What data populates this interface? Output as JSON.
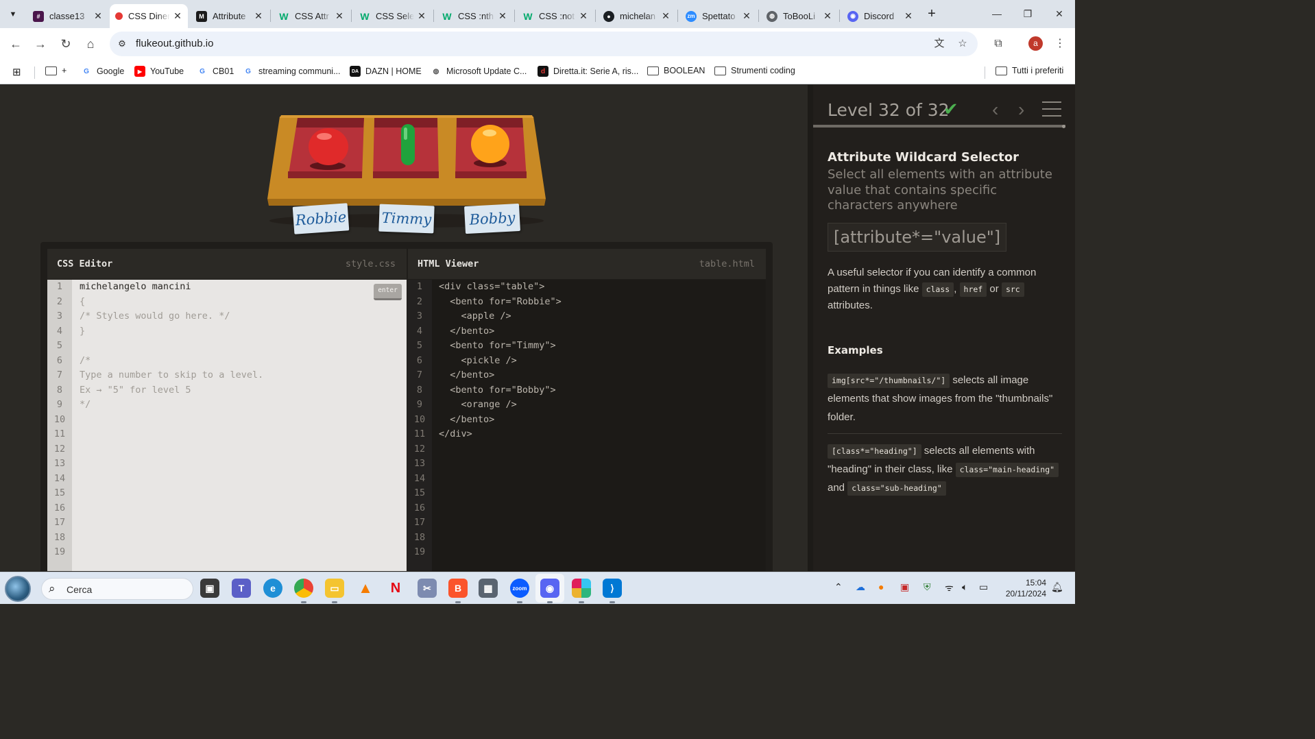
{
  "browser": {
    "tabs": [
      {
        "title": "classe13",
        "favicon": "slack-icon",
        "color": "#4a154b",
        "active": false
      },
      {
        "title": "CSS Diner",
        "favicon": "css-diner-icon",
        "color": "#e53935",
        "active": true
      },
      {
        "title": "Attribute",
        "favicon": "mdn-icon",
        "color": "#1b1b1b",
        "active": false
      },
      {
        "title": "CSS Attr",
        "favicon": "w3schools-icon",
        "color": "#04aa6d",
        "active": false
      },
      {
        "title": "CSS Sele",
        "favicon": "w3schools-icon",
        "color": "#04aa6d",
        "active": false
      },
      {
        "title": "CSS :nth",
        "favicon": "w3schools-icon",
        "color": "#04aa6d",
        "active": false
      },
      {
        "title": "CSS :not",
        "favicon": "w3schools-icon",
        "color": "#04aa6d",
        "active": false
      },
      {
        "title": "michelan",
        "favicon": "github-icon",
        "color": "#1b1f23",
        "active": false
      },
      {
        "title": "Spettato",
        "favicon": "zoom-icon",
        "color": "#2d8cff",
        "active": false
      },
      {
        "title": "ToBooLi",
        "favicon": "globe-icon",
        "color": "#5f6368",
        "active": false
      },
      {
        "title": "Discord",
        "favicon": "discord-icon",
        "color": "#5865f2",
        "active": false
      }
    ],
    "url": "flukeout.github.io",
    "profile_initial": "a",
    "bookmarks": [
      {
        "label": "",
        "icon": "folder-icon"
      },
      {
        "label": "Google",
        "icon": "google-icon"
      },
      {
        "label": "YouTube",
        "icon": "youtube-icon"
      },
      {
        "label": "CB01",
        "icon": "google-icon"
      },
      {
        "label": "streaming communi...",
        "icon": "google-icon"
      },
      {
        "label": "DAZN | HOME",
        "icon": "dazn-icon"
      },
      {
        "label": "Microsoft Update C...",
        "icon": "globe-icon"
      },
      {
        "label": "Diretta.it: Serie A, ris...",
        "icon": "diretta-icon"
      },
      {
        "label": "BOOLEAN",
        "icon": "folder-icon"
      },
      {
        "label": "Strumenti coding",
        "icon": "folder-icon"
      }
    ],
    "all_bookmarks_label": "Tutti i preferiti"
  },
  "game": {
    "plates": [
      {
        "label": "Robbie",
        "item": "apple",
        "item_color": "#e53935"
      },
      {
        "label": "Timmy",
        "item": "pickle",
        "item_color": "#1e9e3a"
      },
      {
        "label": "Bobby",
        "item": "orange",
        "item_color": "#ffa000"
      }
    ],
    "css_editor": {
      "title": "CSS Editor",
      "filename": "style.css",
      "enter_label": "enter",
      "line_count": 19,
      "lines": [
        "michelangelo mancini",
        "{",
        "/* Styles would go here. */",
        "}",
        "",
        "/*",
        "Type a number to skip to a level.",
        "Ex → \"5\" for level 5",
        "*/"
      ]
    },
    "html_viewer": {
      "title": "HTML Viewer",
      "filename": "table.html",
      "line_count": 19,
      "lines": [
        "<div class=\"table\">",
        "  <bento for=\"Robbie\">",
        "    <apple />",
        "  </bento>",
        "  <bento for=\"Timmy\">",
        "    <pickle />",
        "  </bento>",
        "  <bento for=\"Bobby\">",
        "    <orange />",
        "  </bento>",
        "</div>"
      ]
    },
    "level": {
      "label": "Level 32 of 32",
      "current": 32,
      "total": 32,
      "completed": true
    },
    "selector": {
      "name": "Attribute Wildcard Selector",
      "title": "Select all elements with an attribute value that contains specific characters anywhere",
      "syntax": "[attribute*=\"value\"]",
      "hint_parts": [
        "A useful selector if you can identify a common pattern in things like ",
        "class",
        ", ",
        "href",
        " or ",
        "src",
        " attributes."
      ],
      "examples_heading": "Examples",
      "example1_code": "img[src*=\"/thumbnails/\"]",
      "example1_text": " selects all image elements that show images from the \"thumbnails\" folder.",
      "example2_code": "[class*=\"heading\"]",
      "example2_text": " selects all elements with \"heading\" in their class, like ",
      "example2_code2": "class=\"main-heading\"",
      "example2_and": " and ",
      "example2_code3": "class=\"sub-heading\""
    }
  },
  "taskbar": {
    "search_placeholder": "Cerca",
    "time": "15:04",
    "date": "20/11/2024"
  }
}
